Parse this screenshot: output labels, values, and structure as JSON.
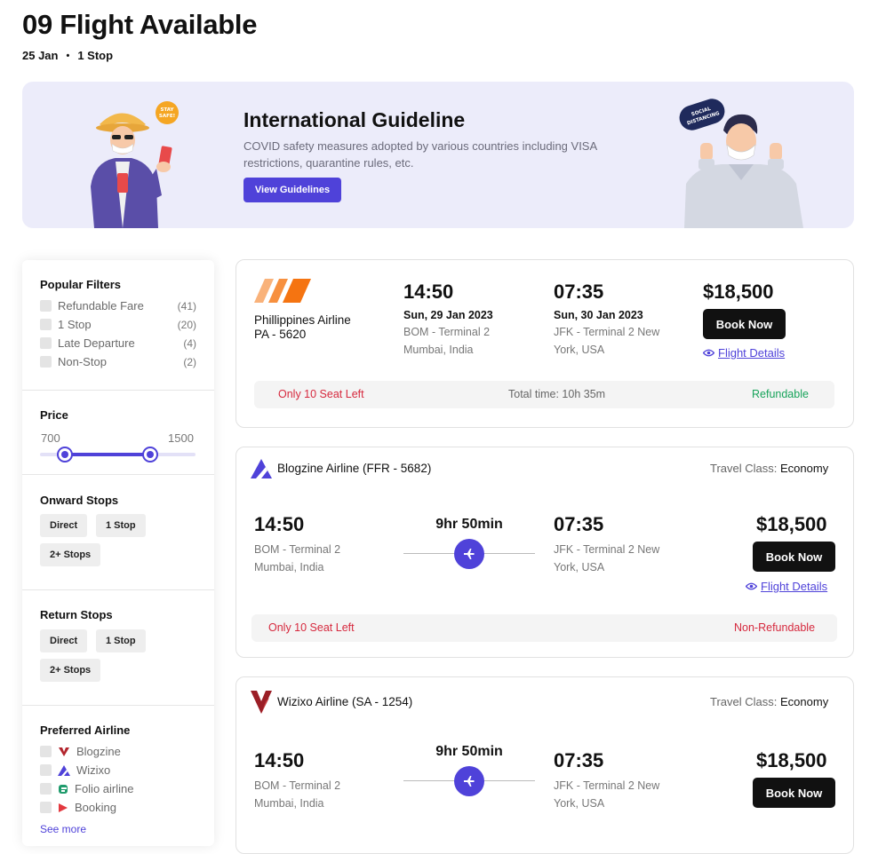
{
  "header": {
    "title": "09 Flight Available",
    "date": "25 Jan",
    "stops": "1 Stop"
  },
  "banner": {
    "title": "International Guideline",
    "description": "COVID safety measures adopted by various countries including VISA restrictions, quarantine rules, etc.",
    "button_label": "View Guidelines",
    "stay_safe_label": "STAY SAFE!",
    "social_distancing_label": "SOCIAL DISTANCING"
  },
  "filters": {
    "popular": {
      "title": "Popular Filters",
      "items": [
        {
          "label": "Refundable Fare",
          "count": "(41)"
        },
        {
          "label": "1 Stop",
          "count": "(20)"
        },
        {
          "label": "Late Departure",
          "count": "(4)"
        },
        {
          "label": "Non-Stop",
          "count": "(2)"
        }
      ]
    },
    "price": {
      "title": "Price",
      "min": "700",
      "max": "1500",
      "low_fraction": 0.16,
      "high_fraction": 0.71
    },
    "onward": {
      "title": "Onward Stops",
      "options": [
        "Direct",
        "1 Stop",
        "2+ Stops"
      ]
    },
    "return": {
      "title": "Return Stops",
      "options": [
        "Direct",
        "1 Stop",
        "2+ Stops"
      ]
    },
    "airline": {
      "title": "Preferred Airline",
      "items": [
        "Blogzine",
        "Wizixo",
        "Folio airline",
        "Booking"
      ],
      "see_more": "See more"
    }
  },
  "flights": [
    {
      "airline": "Phillippines Airline",
      "code": "PA - 5620",
      "depart_time": "14:50",
      "depart_date": "Sun, 29 Jan 2023",
      "depart_airport": "BOM - Terminal 2",
      "depart_city": "Mumbai, India",
      "arrive_time": "07:35",
      "arrive_date": "Sun, 30 Jan 2023",
      "arrive_airport": "JFK - Terminal 2 New",
      "arrive_city": "York, USA",
      "price": "$18,500",
      "book_label": "Book Now",
      "details_label": "Flight Details",
      "seats": "Only 10 Seat Left",
      "total_time": "Total time: 10h 35m",
      "refund": "Refundable"
    },
    {
      "airline": "Blogzine Airline (FFR - 5682)",
      "class_label": "Travel Class:",
      "class_value": "Economy",
      "depart_time": "14:50",
      "depart_airport": "BOM - Terminal 2",
      "depart_city": "Mumbai, India",
      "duration": "9hr 50min",
      "arrive_time": "07:35",
      "arrive_airport": "JFK - Terminal 2 New",
      "arrive_city": "York, USA",
      "price": "$18,500",
      "book_label": "Book Now",
      "details_label": "Flight Details",
      "seats": "Only 10 Seat Left",
      "refund": "Non-Refundable"
    },
    {
      "airline": "Wizixo Airline (SA - 1254)",
      "class_label": "Travel Class:",
      "class_value": "Economy",
      "depart_time": "14:50",
      "depart_airport": "BOM - Terminal 2",
      "depart_city": "Mumbai, India",
      "duration": "9hr 50min",
      "arrive_time": "07:35",
      "arrive_airport": "JFK - Terminal 2 New",
      "arrive_city": "York, USA",
      "price": "$18,500",
      "book_label": "Book Now"
    }
  ],
  "colors": {
    "accent": "#4f42d9",
    "banner_bg": "#ececfa",
    "refundable": "#17a35a",
    "warning": "#d6293e"
  }
}
